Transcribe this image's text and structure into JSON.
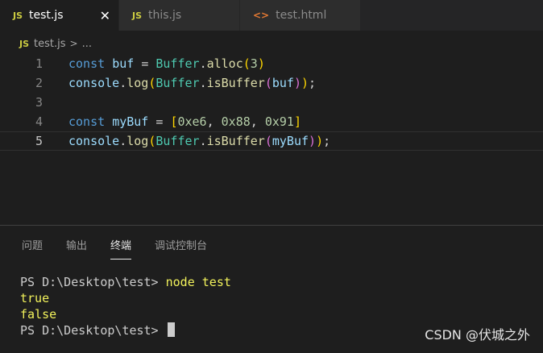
{
  "tabs": [
    {
      "icon": "JS",
      "label": "test.js",
      "close": "✕"
    },
    {
      "icon": "JS",
      "label": "this.js"
    },
    {
      "icon": "<>",
      "label": "test.html"
    }
  ],
  "breadcrumb": {
    "icon": "JS",
    "file": "test.js",
    "separator": ">",
    "more": "..."
  },
  "editor": {
    "line_numbers": [
      "1",
      "2",
      "3",
      "4",
      "5"
    ],
    "current_line": 5,
    "lines": [
      "const buf = Buffer.alloc(3)",
      "console.log(Buffer.isBuffer(buf));",
      "",
      "const myBuf = [0xe6, 0x88, 0x91]",
      "console.log(Buffer.isBuffer(myBuf));"
    ]
  },
  "panel": {
    "tabs": [
      "问题",
      "输出",
      "终端",
      "调试控制台"
    ],
    "active_tab": "终端"
  },
  "terminal": {
    "prompt": "PS D:\\Desktop\\test>",
    "command": "node test",
    "output": [
      "true",
      "false"
    ]
  },
  "watermark": "CSDN @伏城之外",
  "colors": {
    "keyword": "#569cd6",
    "variable": "#9cdcfe",
    "class": "#4ec9b0",
    "function": "#dcdcaa",
    "number": "#b5cea8",
    "terminal_output": "#f1f15b"
  }
}
